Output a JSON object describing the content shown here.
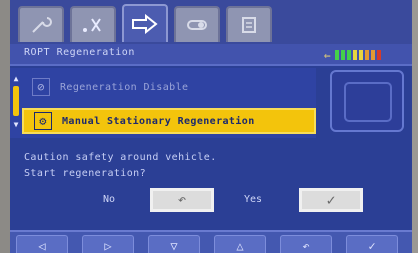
{
  "header": {
    "title": "ROPT Regeneration",
    "signal_icon": "arrow-icon"
  },
  "tabs": [
    {
      "name": "tab-service",
      "icon": "wrench-icon"
    },
    {
      "name": "tab-tools",
      "icon": "tools-icon"
    },
    {
      "name": "tab-regeneration",
      "icon": "arrow-right-icon",
      "active": true
    },
    {
      "name": "tab-settings",
      "icon": "switch-icon"
    },
    {
      "name": "tab-info",
      "icon": "document-icon"
    }
  ],
  "list": {
    "items": [
      {
        "label": "Regeneration Disable",
        "icon": "disable-icon"
      },
      {
        "label": "Manual Stationary Regeneration",
        "icon": "manual-regen-icon",
        "selected": true
      }
    ]
  },
  "message": {
    "line1": "Caution safety around vehicle.",
    "line2": "Start regeneration?"
  },
  "buttons": {
    "no_label": "No",
    "no_glyph": "↶",
    "yes_label": "Yes",
    "yes_glyph": "✓"
  },
  "softkeys": [
    "◁",
    "▷",
    "▽",
    "△",
    "↶",
    "✓"
  ],
  "colors": {
    "background": "#2b3f95",
    "highlight": "#f3c40c",
    "button": "#dcdcdc"
  }
}
